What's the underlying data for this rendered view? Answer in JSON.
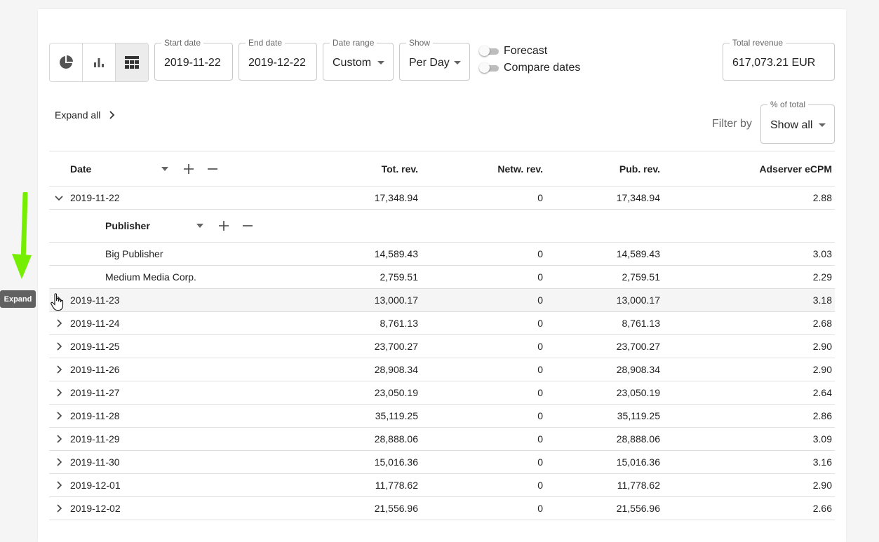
{
  "toolbar": {
    "view_icons": [
      "pie-chart-icon",
      "bar-chart-icon",
      "table-icon"
    ],
    "start_date": {
      "label": "Start date",
      "value": "2019-11-22"
    },
    "end_date": {
      "label": "End date",
      "value": "2019-12-22"
    },
    "date_range": {
      "label": "Date range",
      "value": "Custom"
    },
    "show": {
      "label": "Show",
      "value": "Per Day"
    },
    "forecast_label": "Forecast",
    "compare_label": "Compare dates",
    "total_revenue": {
      "label": "Total revenue",
      "value": "617,073.21 EUR"
    }
  },
  "expand_all_label": "Expand all",
  "filter": {
    "label": "Filter by",
    "field_label": "% of total",
    "value": "Show all"
  },
  "table": {
    "columns": {
      "date": "Date",
      "tot": "Tot. rev.",
      "netw": "Netw. rev.",
      "pub": "Pub. rev.",
      "ecpm": "Adserver eCPM"
    },
    "first_row": {
      "date": "2019-11-22",
      "tot": "17,348.94",
      "netw": "0",
      "pub": "17,348.94",
      "ecpm": "2.88"
    },
    "sub_header": "Publisher",
    "sub_rows": [
      {
        "name": "Big Publisher",
        "tot": "14,589.43",
        "netw": "0",
        "pub": "14,589.43",
        "ecpm": "3.03"
      },
      {
        "name": "Medium Media Corp.",
        "tot": "2,759.51",
        "netw": "0",
        "pub": "2,759.51",
        "ecpm": "2.29"
      }
    ],
    "rows": [
      {
        "date": "2019-11-23",
        "tot": "13,000.17",
        "netw": "0",
        "pub": "13,000.17",
        "ecpm": "3.18"
      },
      {
        "date": "2019-11-24",
        "tot": "8,761.13",
        "netw": "0",
        "pub": "8,761.13",
        "ecpm": "2.68"
      },
      {
        "date": "2019-11-25",
        "tot": "23,700.27",
        "netw": "0",
        "pub": "23,700.27",
        "ecpm": "2.90"
      },
      {
        "date": "2019-11-26",
        "tot": "28,908.34",
        "netw": "0",
        "pub": "28,908.34",
        "ecpm": "2.90"
      },
      {
        "date": "2019-11-27",
        "tot": "23,050.19",
        "netw": "0",
        "pub": "23,050.19",
        "ecpm": "2.64"
      },
      {
        "date": "2019-11-28",
        "tot": "35,119.25",
        "netw": "0",
        "pub": "35,119.25",
        "ecpm": "2.86"
      },
      {
        "date": "2019-11-29",
        "tot": "28,888.06",
        "netw": "0",
        "pub": "28,888.06",
        "ecpm": "3.09"
      },
      {
        "date": "2019-11-30",
        "tot": "15,016.36",
        "netw": "0",
        "pub": "15,016.36",
        "ecpm": "3.16"
      },
      {
        "date": "2019-12-01",
        "tot": "11,778.62",
        "netw": "0",
        "pub": "11,778.62",
        "ecpm": "2.90"
      },
      {
        "date": "2019-12-02",
        "tot": "21,556.96",
        "netw": "0",
        "pub": "21,556.96",
        "ecpm": "2.66"
      }
    ]
  },
  "annotation": {
    "tooltip": "Expand",
    "arrow_color": "#76ee00"
  }
}
